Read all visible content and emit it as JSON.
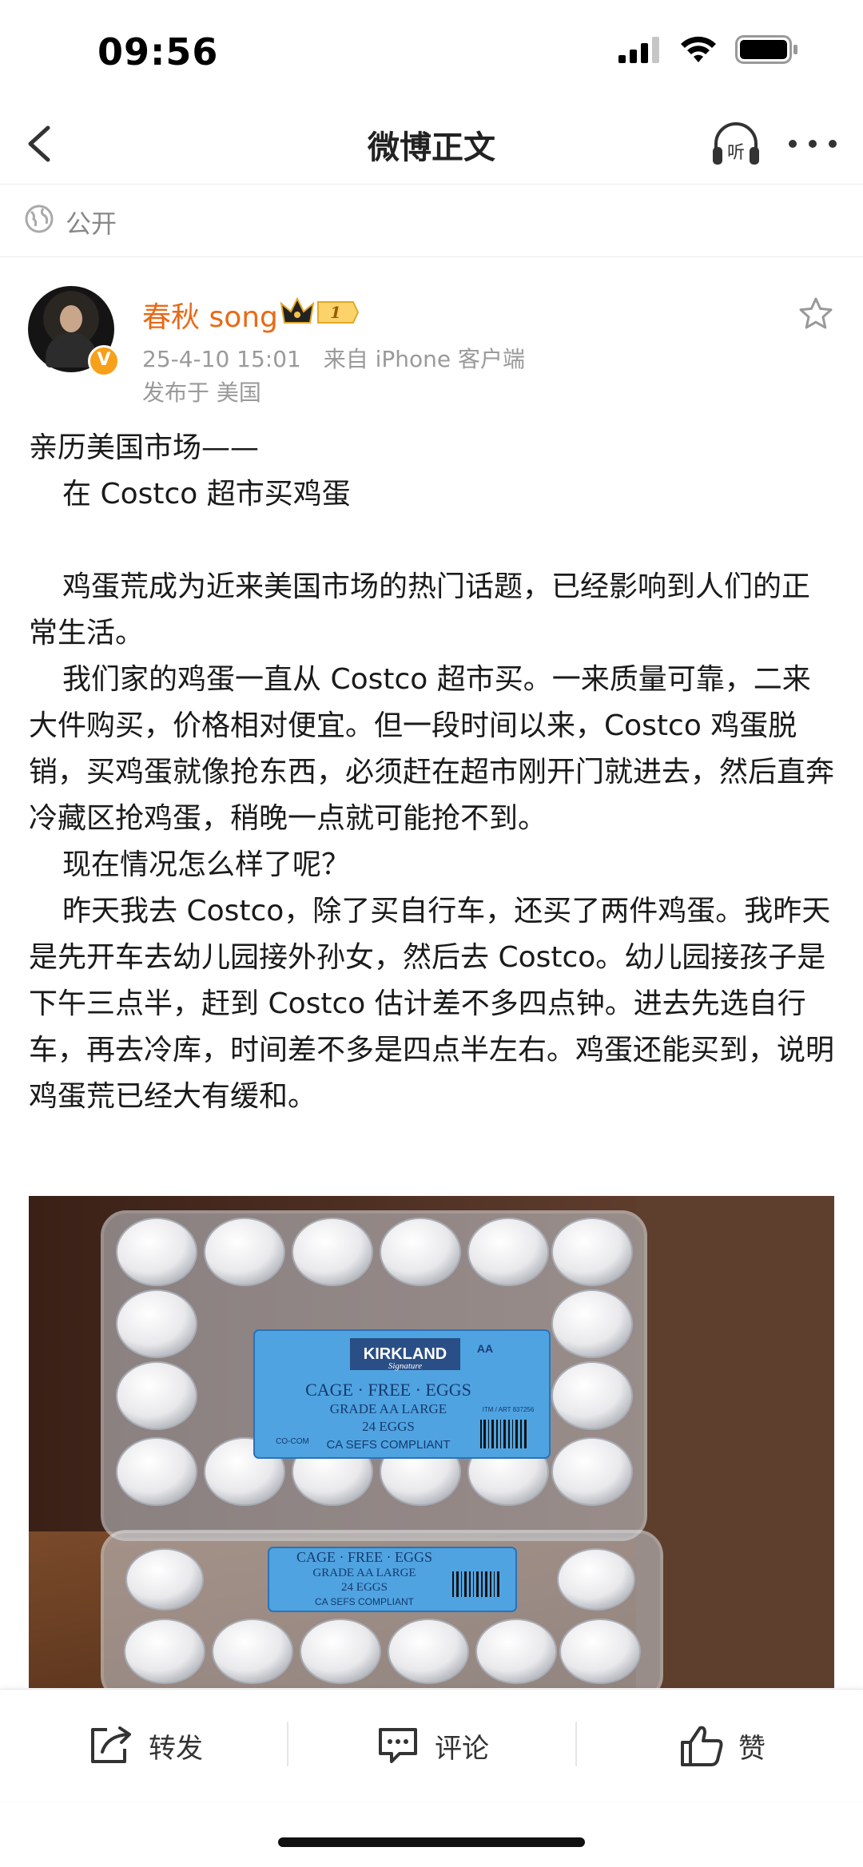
{
  "status_bar": {
    "time": "09:56"
  },
  "nav": {
    "title": "微博正文",
    "listen_label": "听"
  },
  "visibility": {
    "label": "公开"
  },
  "author": {
    "name": "春秋 song",
    "member_level": "1",
    "verified_mark": "V",
    "timestamp": "25-4-10 15:01",
    "source": "来自 iPhone 客户端",
    "location": "发布于 美国"
  },
  "post": {
    "paragraphs": [
      {
        "text": "亲历美国市场——",
        "indent": false
      },
      {
        "text": "在 Costco 超市买鸡蛋",
        "indent": true
      },
      {
        "text": "",
        "indent": false
      },
      {
        "text": "鸡蛋荒成为近来美国市场的热门话题，已经影响到人们的正常生活。",
        "indent": true
      },
      {
        "text": "我们家的鸡蛋一直从 Costco 超市买。一来质量可靠，二来大件购买，价格相对便宜。但一段时间以来，Costco 鸡蛋脱销，买鸡蛋就像抢东西，必须赶在超市刚开门就进去，然后直奔冷藏区抢鸡蛋，稍晚一点就可能抢不到。",
        "indent": true
      },
      {
        "text": "现在情况怎么样了呢？",
        "indent": true
      },
      {
        "text": "昨天我去 Costco，除了买自行车，还买了两件鸡蛋。我昨天是先开车去幼儿园接外孙女，然后去 Costco。幼儿园接孩子是下午三点半，赶到 Costco 估计差不多四点钟。进去先选自行车，再去冷库，时间差不多是四点半左右。鸡蛋还能买到，说明鸡蛋荒已经大有缓和。",
        "indent": true
      }
    ]
  },
  "photo": {
    "label_brand": "KIRKLAND",
    "label_brand_sub": "Signature",
    "label_line1": "CAGE · FREE · EGGS",
    "label_line2": "GRADE AA LARGE",
    "label_line3": "24 EGGS",
    "label_line4": "CA SEFS COMPLIANT",
    "label_grade_mark": "AA",
    "label_item": "ITM / ART 837256",
    "label_cocom": "CO-COM",
    "label2_line1": "CAGE · FREE · EGGS",
    "label2_line2": "GRADE AA LARGE",
    "label2_line3": "24 EGGS",
    "label2_line4": "CA SEFS COMPLIANT"
  },
  "actions": {
    "repost": "转发",
    "comment": "评论",
    "like": "赞"
  },
  "colors": {
    "author_name": "#e86a17",
    "verified": "#f7a11a",
    "meta": "#9a9a9a"
  }
}
